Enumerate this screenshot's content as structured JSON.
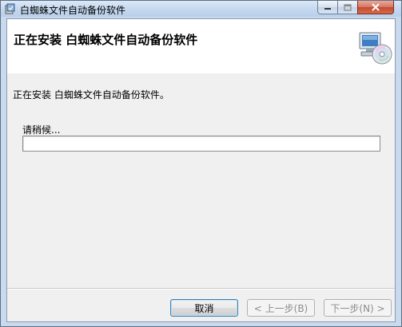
{
  "window": {
    "title": "白蜘蛛文件自动备份软件"
  },
  "header": {
    "title": "正在安装 白蜘蛛文件自动备份软件",
    "icon": "computer-cd-icon"
  },
  "main": {
    "status_text": "正在安装 白蜘蛛文件自动备份软件。",
    "wait_label": "请稍候...",
    "progress": 0
  },
  "buttons": {
    "cancel": "取消",
    "back": "< 上一步(B)",
    "next": "下一步(N) >"
  },
  "colors": {
    "accent": "#3c7fb1",
    "titlebar": "#c4d7ef",
    "close": "#c24a2f"
  }
}
